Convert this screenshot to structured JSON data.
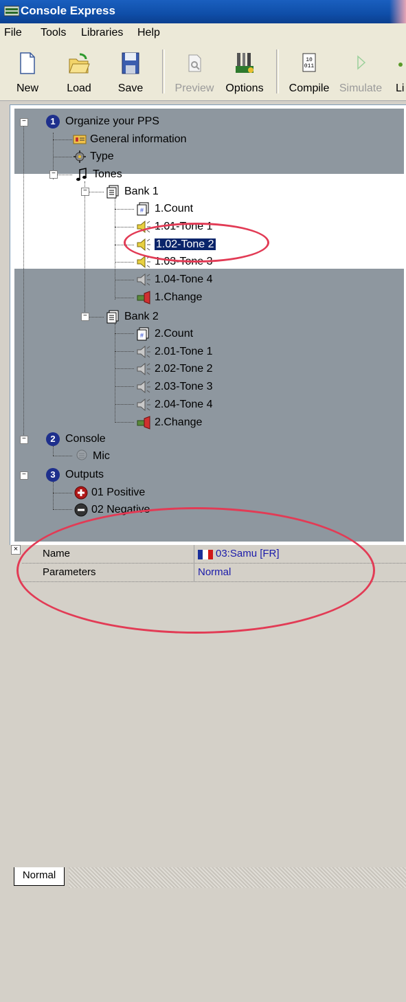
{
  "window": {
    "title": "Console Express"
  },
  "menu": [
    "File",
    "Tools",
    "Libraries",
    "Help"
  ],
  "toolbar": {
    "new": "New",
    "load": "Load",
    "save": "Save",
    "preview": "Preview",
    "options": "Options",
    "compile": "Compile",
    "simulate": "Simulate",
    "li": "Li"
  },
  "tree": {
    "s1": {
      "num": "1",
      "label": "Organize your PPS"
    },
    "general": "General information",
    "type": "Type",
    "tones": "Tones",
    "bank1": "Bank 1",
    "b1": [
      "1.Count",
      "1.01-Tone 1",
      "1.02-Tone 2",
      "1.03-Tone 3",
      "1.04-Tone 4",
      "1.Change"
    ],
    "bank2": "Bank 2",
    "b2": [
      "2.Count",
      "2.01-Tone 1",
      "2.02-Tone 2",
      "2.03-Tone 3",
      "2.04-Tone 4",
      "2.Change"
    ],
    "s2": {
      "num": "2",
      "label": "Console"
    },
    "mic": "Mic",
    "s3": {
      "num": "3",
      "label": "Outputs"
    },
    "pos": "01 Positive",
    "neg": "02 Negative"
  },
  "properties": {
    "name_label": "Name",
    "name_value": "03:Samu [FR]",
    "params_label": "Parameters",
    "params_value": "Normal"
  },
  "tabs": {
    "normal": "Normal"
  },
  "colors": {
    "selection": "#0a246a",
    "annotation": "#e23b55",
    "overlay": "#8e979f"
  }
}
